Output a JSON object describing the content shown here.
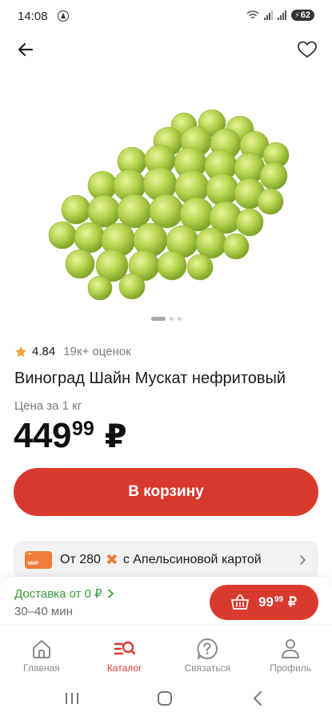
{
  "status_bar": {
    "time": "14:08",
    "battery": "62",
    "icons": [
      "navigation-icon",
      "wifi-icon",
      "signal-icon",
      "signal-icon",
      "battery-icon"
    ]
  },
  "header": {
    "back_icon": "arrow-left-icon",
    "favorite_icon": "heart-outline-icon"
  },
  "gallery": {
    "image": "green-grapes-bunch",
    "total_slides": 3,
    "active_slide": 1
  },
  "product": {
    "rating": "4.84",
    "reviews": "19к+ оценок",
    "title": "Виноград Шайн Мускат нефритовый",
    "price_unit": "Цена за 1 кг",
    "price_main": "449",
    "price_cents": "99",
    "currency": "₽"
  },
  "actions": {
    "add_to_cart": "В корзину"
  },
  "promo": {
    "card_label": "МИР",
    "prefix": "От 280",
    "text": "с Апельсиновой картой"
  },
  "delivery": {
    "label": "Доставка от 0 ₽",
    "time": "30–40 мин",
    "basket_main": "99",
    "basket_cents": "99",
    "basket_currency": "₽"
  },
  "tabs": [
    {
      "label": "Главная",
      "icon": "home-icon"
    },
    {
      "label": "Каталог",
      "icon": "catalog-search-icon"
    },
    {
      "label": "Связаться",
      "icon": "help-icon"
    },
    {
      "label": "Профиль",
      "icon": "profile-icon"
    }
  ],
  "active_tab": "Каталог",
  "colors": {
    "accent": "#d93a2e",
    "delivery_green": "#3a9a3a",
    "promo_orange": "#ef7d3a",
    "star": "#f2a03a"
  }
}
